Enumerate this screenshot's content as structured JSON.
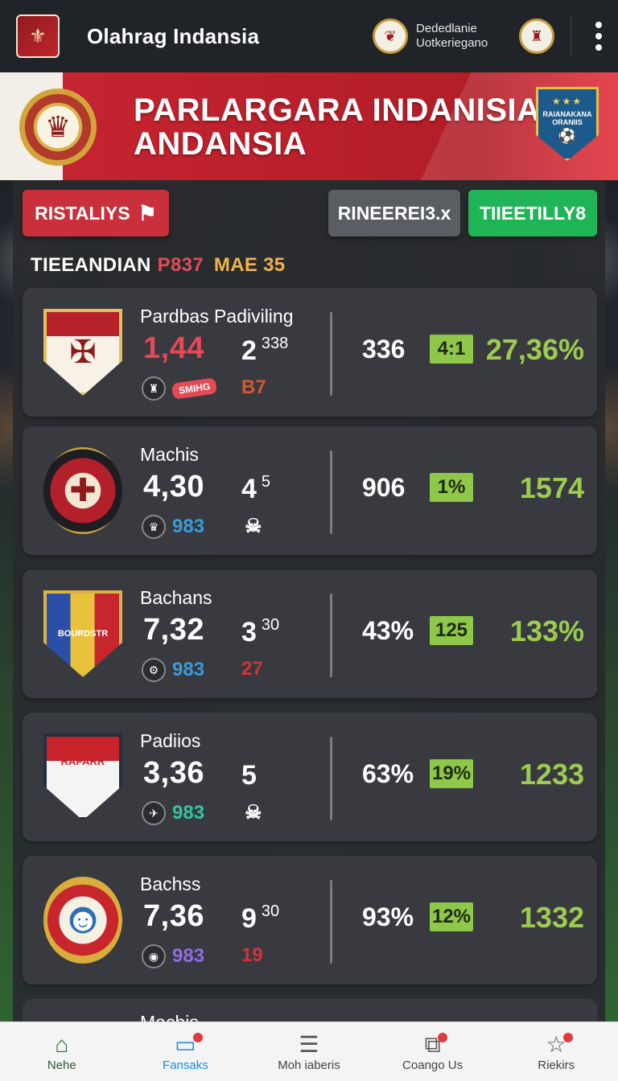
{
  "app": {
    "title": "Olahrag Indansia"
  },
  "header_club": {
    "line1": "Dededlanie",
    "line2": "Uotkeriegano"
  },
  "banner": {
    "title_line1": "PARLARGARA INDANISIA",
    "title_line2": "ANDANSIA",
    "crest_text": "RAIANAKANA ORANIIS"
  },
  "actions": {
    "red_label": "RISTALIYS",
    "grey_label": "RINEEREI3.x",
    "green_label": "TIIEETILLY8"
  },
  "section": {
    "title_a": "TIEEANDIAN",
    "title_b": "P837",
    "title_c": "MAE 35"
  },
  "matches": [
    {
      "team": "Pardbas Padiviling",
      "score": "1,44",
      "sub": "2",
      "sub_sup": "338",
      "mini_num": "",
      "mini_tag": "SMIHG",
      "extra": "B7",
      "stat": "336",
      "odds": "4:1",
      "pct": "27,36%"
    },
    {
      "team": "Machis",
      "score": "4,30",
      "sub": "4",
      "sub_sup": "5",
      "mini_num": "983",
      "mini_tag": "",
      "extra": "",
      "stat": "906",
      "odds": "1%",
      "pct": "1574"
    },
    {
      "team": "Bachans",
      "score": "7,32",
      "sub": "3",
      "sub_sup": "30",
      "mini_num": "983",
      "mini_tag": "",
      "extra": "27",
      "stat": "43%",
      "odds": "125",
      "pct": "133%",
      "crest_text": "BOURDSTR"
    },
    {
      "team": "Padiios",
      "score": "3,36",
      "sub": "5",
      "sub_sup": "",
      "mini_num": "983",
      "mini_tag": "",
      "extra": "",
      "stat": "63%",
      "odds": "19%",
      "pct": "1233",
      "crest_text": "RAPARR"
    },
    {
      "team": "Bachss",
      "score": "7,36",
      "sub": "9",
      "sub_sup": "30",
      "mini_num": "983",
      "mini_tag": "",
      "extra": "19",
      "stat": "93%",
      "odds": "12%",
      "pct": "1332"
    }
  ],
  "peek_card": {
    "team": "Machis"
  },
  "nav": [
    {
      "label": "Nehe",
      "icon": "home-icon"
    },
    {
      "label": "Fansaks",
      "icon": "inbox-icon"
    },
    {
      "label": "Moh iaberis",
      "icon": "document-icon"
    },
    {
      "label": "Coango Us",
      "icon": "chart-icon"
    },
    {
      "label": "Riekirs",
      "icon": "star-icon"
    }
  ],
  "colors": {
    "accent_red": "#c9303b",
    "accent_green": "#1fb556",
    "positive_green": "#9ccc4f",
    "nav_active": "#1a8be0"
  }
}
